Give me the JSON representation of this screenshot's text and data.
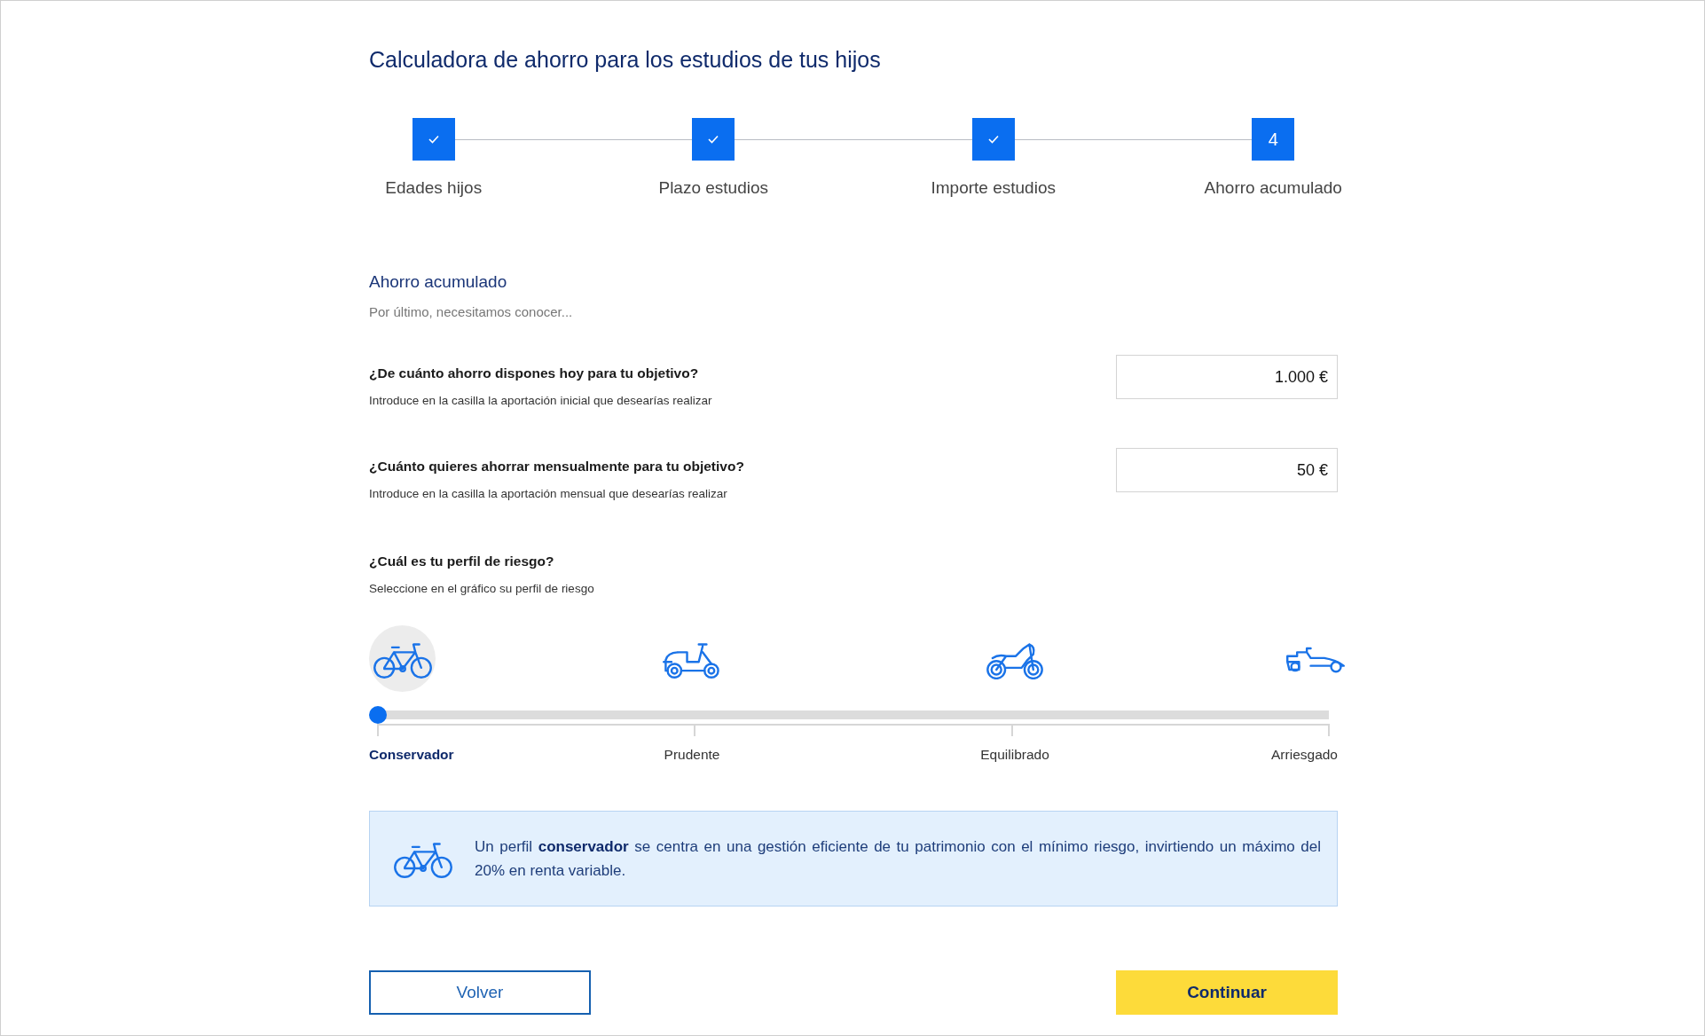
{
  "title": "Calculadora de ahorro para los estudios de tus hijos",
  "steps": [
    {
      "label": "Edades hijos",
      "completed": true
    },
    {
      "label": "Plazo estudios",
      "completed": true
    },
    {
      "label": "Importe estudios",
      "completed": true
    },
    {
      "label": "Ahorro acumulado",
      "completed": false,
      "number": "4"
    }
  ],
  "section": {
    "title": "Ahorro acumulado",
    "subtitle": "Por último, necesitamos conocer..."
  },
  "questions": [
    {
      "question": "¿De cuánto ahorro dispones hoy para tu objetivo?",
      "hint": "Introduce en la casilla la aportación inicial que desearías realizar",
      "value": "1.000 €"
    },
    {
      "question": "¿Cuánto quieres ahorrar mensualmente para tu objetivo?",
      "hint": "Introduce en la casilla la aportación mensual que desearías realizar",
      "value": "50 €"
    }
  ],
  "risk": {
    "question": "¿Cuál es tu perfil de riesgo?",
    "hint": "Seleccione en el gráfico su perfil de riesgo",
    "level": 0,
    "profiles": [
      {
        "label": "Conservador",
        "kind": "bicycle",
        "selected": true
      },
      {
        "label": "Prudente",
        "kind": "scooter",
        "selected": false
      },
      {
        "label": "Equilibrado",
        "kind": "motorcycle",
        "selected": false
      },
      {
        "label": "Arriesgado",
        "kind": "racecar",
        "selected": false
      }
    ]
  },
  "info": {
    "kind": "bicycle",
    "text": "Un perfil **conservador** se centra en una gestión eficiente de tu patrimonio con el mínimo riesgo, invirtiendo un máximo del 20% en renta variable."
  },
  "buttons": {
    "back": "Volver",
    "next": "Continuar"
  }
}
